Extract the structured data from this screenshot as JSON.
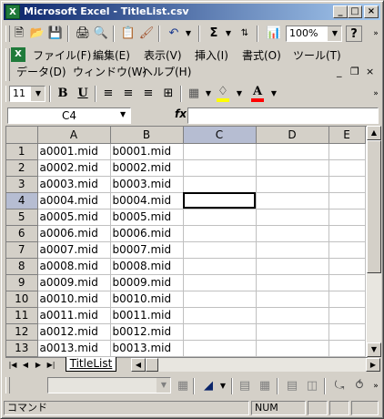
{
  "window": {
    "title": "Microsoft Excel - TitleList.csv",
    "app_icon": "X",
    "controls": [
      "_",
      "□",
      "×"
    ]
  },
  "toolbar": {
    "icons": [
      "new-icon",
      "open-icon",
      "save-icon",
      "print-icon",
      "print-preview-icon",
      "copy-icon",
      "format-painter-icon",
      "undo-icon",
      "sum-icon",
      "sort-icon",
      "chart-icon"
    ],
    "sum_glyph": "Σ",
    "zoom": "100%",
    "help_glyph": "?"
  },
  "menubar": {
    "items": [
      "ファイル(F)",
      "編集(E)",
      "表示(V)",
      "挿入(I)",
      "書式(O)",
      "ツール(T)",
      "データ(D)",
      "ウィンドウ(W)",
      "ヘルプ(H)"
    ],
    "doc_controls": [
      "_",
      "❐",
      "×"
    ]
  },
  "format_toolbar": {
    "font_size": "11",
    "bold": "B",
    "underline": "U",
    "font_color_glyph": "A",
    "fill_color": "#ffff00",
    "font_color": "#ff0000"
  },
  "formula_bar": {
    "name_box": "C4",
    "fx": "fx",
    "value": ""
  },
  "sheet": {
    "columns": [
      "A",
      "B",
      "C",
      "D",
      "E"
    ],
    "selected_column": "C",
    "selected_row": "4",
    "rows": [
      {
        "n": "1",
        "a": "a0001.mid",
        "b": "b0001.mid"
      },
      {
        "n": "2",
        "a": "a0002.mid",
        "b": "b0002.mid"
      },
      {
        "n": "3",
        "a": "a0003.mid",
        "b": "b0003.mid"
      },
      {
        "n": "4",
        "a": "a0004.mid",
        "b": "b0004.mid"
      },
      {
        "n": "5",
        "a": "a0005.mid",
        "b": "b0005.mid"
      },
      {
        "n": "6",
        "a": "a0006.mid",
        "b": "b0006.mid"
      },
      {
        "n": "7",
        "a": "a0007.mid",
        "b": "b0007.mid"
      },
      {
        "n": "8",
        "a": "a0008.mid",
        "b": "b0008.mid"
      },
      {
        "n": "9",
        "a": "a0009.mid",
        "b": "b0009.mid"
      },
      {
        "n": "10",
        "a": "a0010.mid",
        "b": "b0010.mid"
      },
      {
        "n": "11",
        "a": "a0011.mid",
        "b": "b0011.mid"
      },
      {
        "n": "12",
        "a": "a0012.mid",
        "b": "b0012.mid"
      },
      {
        "n": "13",
        "a": "a0013.mid",
        "b": "b0013.mid"
      }
    ]
  },
  "tabs": {
    "sheet_name": "TitleList"
  },
  "status": {
    "mode": "コマンド",
    "num": "NUM"
  }
}
